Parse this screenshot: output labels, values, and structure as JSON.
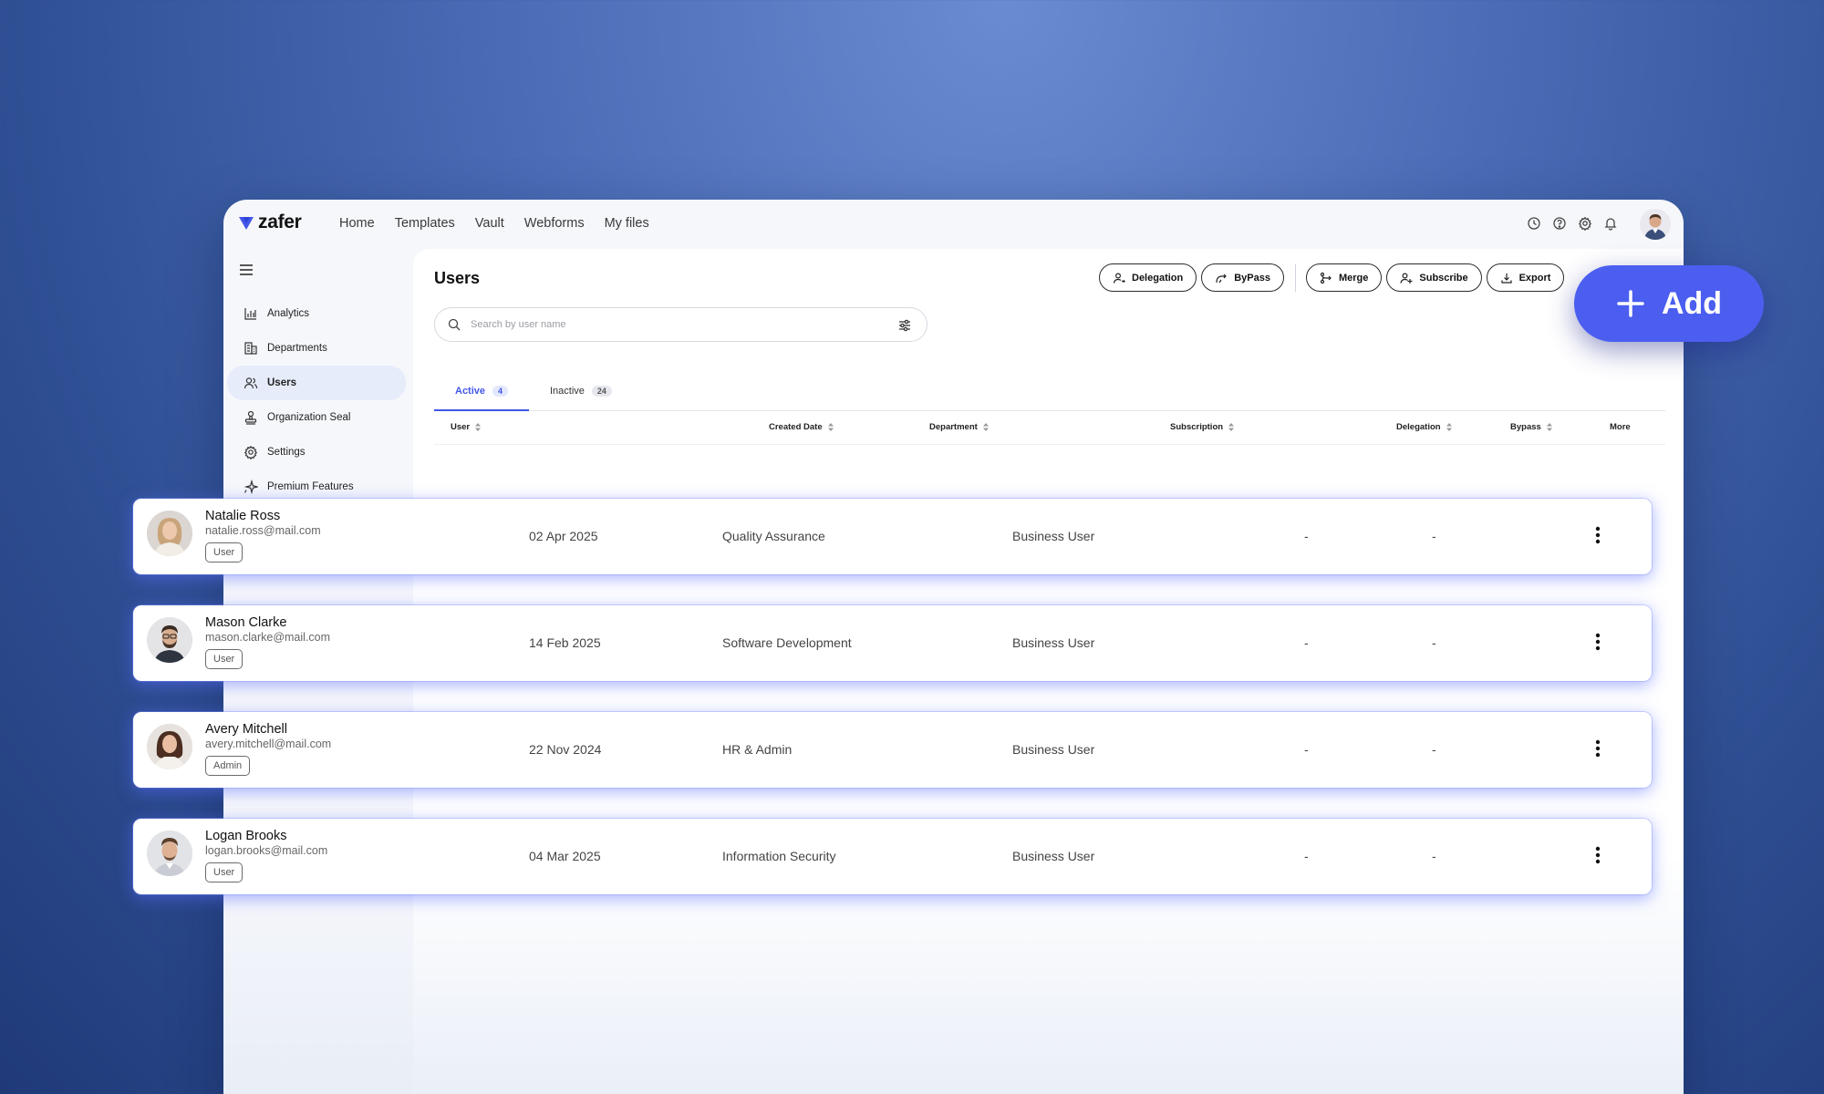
{
  "app": {
    "brand": "zafer",
    "accent": "#4257e8"
  },
  "nav": [
    "Home",
    "Templates",
    "Vault",
    "Webforms",
    "My files"
  ],
  "top_icons": [
    "clock-icon",
    "help-icon",
    "gear-icon",
    "bell-icon"
  ],
  "sidebar": {
    "items": [
      {
        "label": "Analytics",
        "icon": "chart-icon"
      },
      {
        "label": "Departments",
        "icon": "building-icon"
      },
      {
        "label": "Users",
        "icon": "users-icon",
        "active": true
      },
      {
        "label": "Organization Seal",
        "icon": "stamp-icon"
      },
      {
        "label": "Settings",
        "icon": "gear-icon"
      },
      {
        "label": "Premium Features",
        "icon": "sparkle-icon"
      }
    ]
  },
  "page": {
    "title": "Users"
  },
  "toolbar": {
    "delegation": "Delegation",
    "bypass": "ByPass",
    "merge": "Merge",
    "subscribe": "Subscribe",
    "export": "Export"
  },
  "add_button": {
    "label": "Add"
  },
  "search": {
    "placeholder": "Search by user name"
  },
  "tabs": [
    {
      "label": "Active",
      "count": "4",
      "active": true
    },
    {
      "label": "Inactive",
      "count": "24",
      "active": false
    }
  ],
  "columns": [
    "User",
    "Created Date",
    "Department",
    "Subscription",
    "Delegation",
    "Bypass",
    "More"
  ],
  "rows": [
    {
      "name": "Natalie Ross",
      "email": "natalie.ross@mail.com",
      "role": "User",
      "created": "02 Apr 2025",
      "department": "Quality Assurance",
      "subscription": "Business User",
      "delegation": "-",
      "bypass": "-"
    },
    {
      "name": "Mason Clarke",
      "email": "mason.clarke@mail.com",
      "role": "User",
      "created": "14 Feb 2025",
      "department": "Software Development",
      "subscription": "Business User",
      "delegation": "-",
      "bypass": "-"
    },
    {
      "name": "Avery Mitchell",
      "email": "avery.mitchell@mail.com",
      "role": "Admin",
      "created": "22 Nov 2024",
      "department": "HR & Admin",
      "subscription": "Business User",
      "delegation": "-",
      "bypass": "-"
    },
    {
      "name": "Logan Brooks",
      "email": "logan.brooks@mail.com",
      "role": "User",
      "created": "04 Mar 2025",
      "department": "Information Security",
      "subscription": "Business User",
      "delegation": "-",
      "bypass": "-"
    }
  ]
}
